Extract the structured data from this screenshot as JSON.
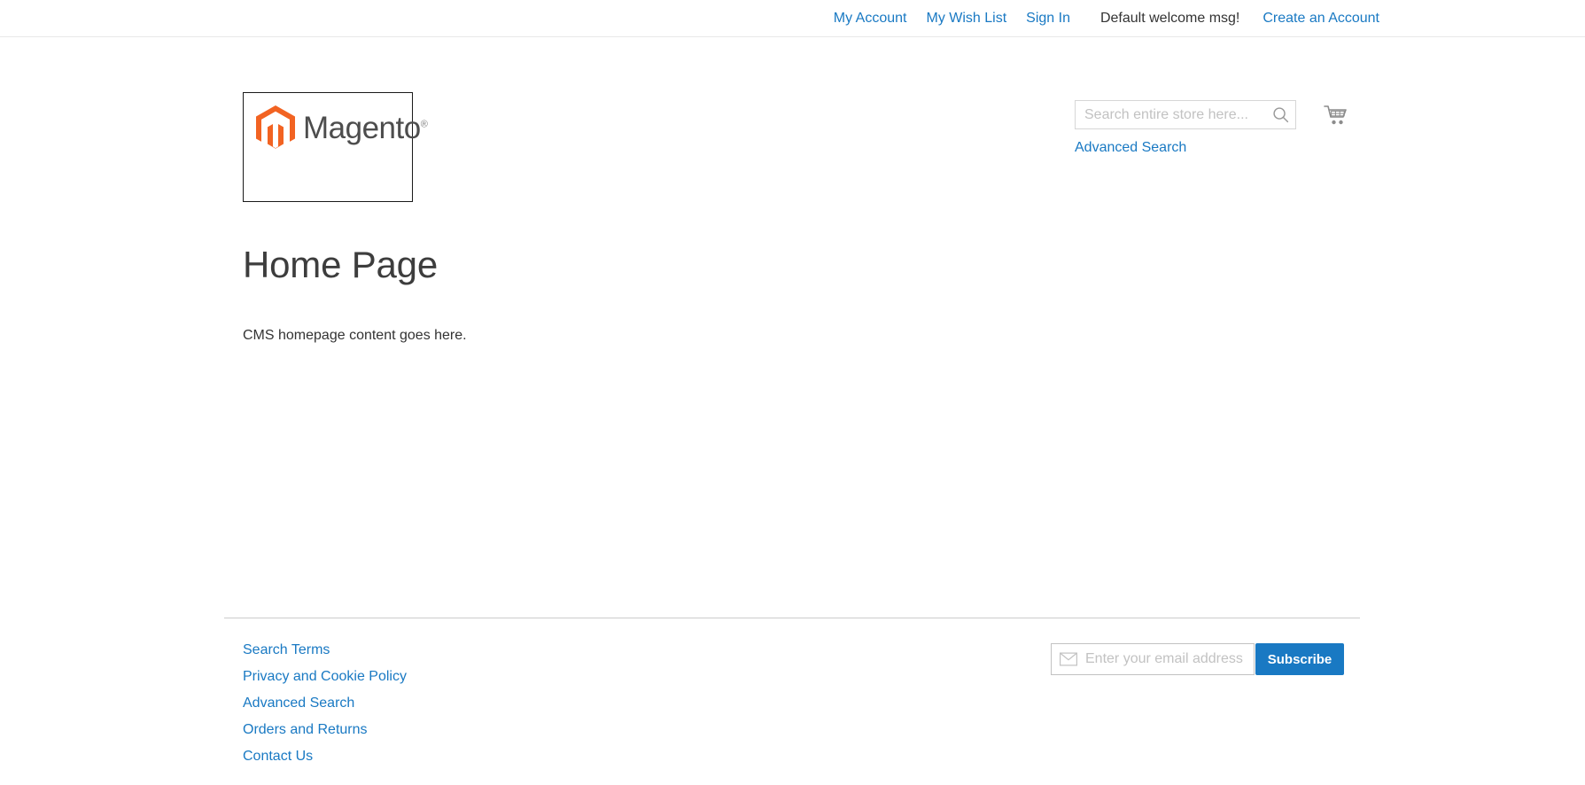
{
  "top_panel": {
    "links": [
      {
        "label": "My Account",
        "name": "my-account-link"
      },
      {
        "label": "My Wish List",
        "name": "my-wish-list-link"
      },
      {
        "label": "Sign In",
        "name": "sign-in-link"
      }
    ],
    "welcome_message": "Default welcome msg!",
    "create_account_label": "Create an Account"
  },
  "header": {
    "logo_text": "Magento",
    "logo_registered": "®",
    "search": {
      "placeholder": "Search entire store here...",
      "value": "",
      "button_icon": "search-icon"
    },
    "advanced_search_label": "Advanced Search",
    "cart_icon": "shopping-cart-icon"
  },
  "main": {
    "page_title": "Home Page",
    "content_text": "CMS homepage content goes here."
  },
  "footer": {
    "links": [
      {
        "label": "Search Terms",
        "name": "footer-link-search-terms"
      },
      {
        "label": "Privacy and Cookie Policy",
        "name": "footer-link-privacy-policy"
      },
      {
        "label": "Advanced Search",
        "name": "footer-link-advanced-search"
      },
      {
        "label": "Orders and Returns",
        "name": "footer-link-orders-returns"
      },
      {
        "label": "Contact Us",
        "name": "footer-link-contact-us"
      }
    ],
    "newsletter": {
      "placeholder": "Enter your email address",
      "value": "",
      "subscribe_label": "Subscribe",
      "icon": "envelope-icon"
    }
  },
  "colors": {
    "link_blue": "#1979c3",
    "magento_orange": "#f26322",
    "text_dark": "#333333",
    "border_light": "#d6d6d6"
  }
}
